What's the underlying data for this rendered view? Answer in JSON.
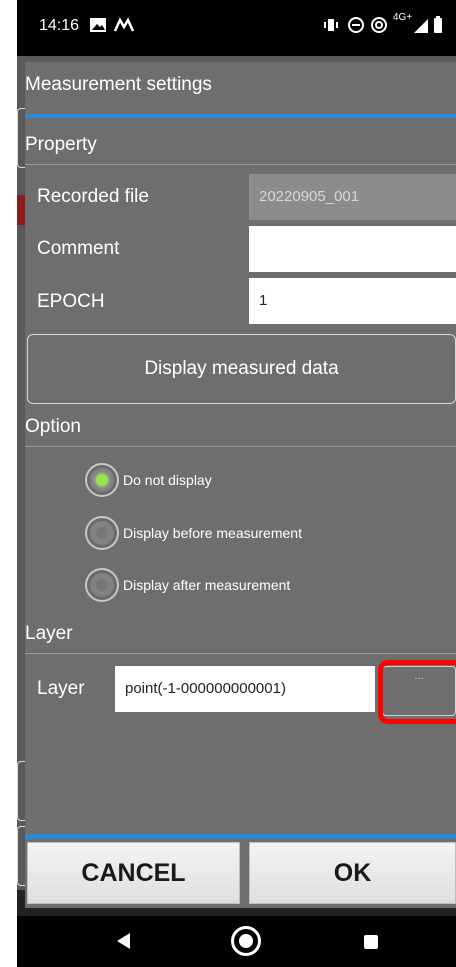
{
  "status_bar": {
    "time": "14:16",
    "right_indicators": "4G+"
  },
  "dialog": {
    "title": "Measurement settings",
    "property": {
      "section_label": "Property",
      "recorded_file": {
        "label": "Recorded file",
        "value": "20220905_001"
      },
      "comment": {
        "label": "Comment",
        "value": ""
      },
      "epoch": {
        "label": "EPOCH",
        "value": "1"
      },
      "display_button": "Display measured data"
    },
    "option": {
      "section_label": "Option",
      "radios": [
        {
          "label": "Do not display",
          "selected": true
        },
        {
          "label": "Display before measurement",
          "selected": false
        },
        {
          "label": "Display after measurement",
          "selected": false
        }
      ]
    },
    "layer": {
      "section_label": "Layer",
      "label": "Layer",
      "value": "point(-1-000000000001)",
      "browse_button": "..."
    },
    "buttons": {
      "cancel": "CANCEL",
      "ok": "OK"
    }
  },
  "colors": {
    "accent": "#2a8bd4",
    "highlight": "#ff0000",
    "radio_selected": "#96e64b"
  }
}
